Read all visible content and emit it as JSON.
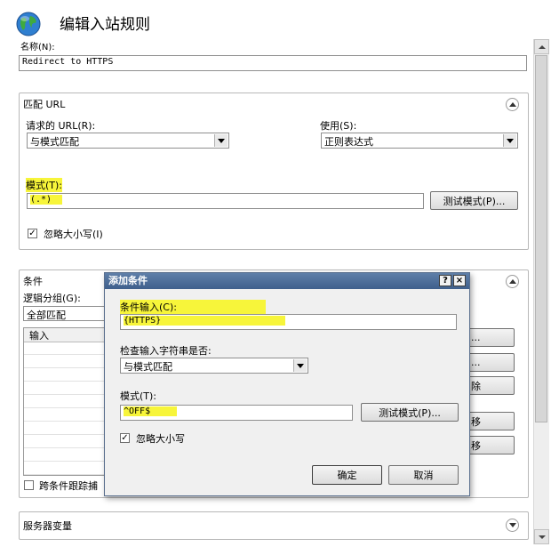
{
  "header": {
    "title": "编辑入站规则",
    "icon": "globe-icon"
  },
  "name_field": {
    "label": "名称(N):",
    "value": "Redirect to HTTPS"
  },
  "match_url": {
    "title": "匹配 URL",
    "requested_url_label": "请求的 URL(R):",
    "requested_url_value": "与模式匹配",
    "using_label": "使用(S):",
    "using_value": "正则表达式",
    "pattern_label": "模式(T):",
    "pattern_value": "(.*)",
    "test_pattern_button": "测试模式(P)...",
    "ignore_case_label": "忽略大小写(I)",
    "ignore_case_checked": true
  },
  "conditions": {
    "title": "条件",
    "logical_group_label": "逻辑分组(G):",
    "logical_group_value": "全部匹配",
    "table_header_input": "输入",
    "side_buttons": [
      "...",
      "...",
      "除",
      "移",
      "移"
    ],
    "track_captures_label": "跨条件跟踪捕"
  },
  "server_variables": {
    "title": "服务器变量"
  },
  "dialog": {
    "title": "添加条件",
    "help_button": "?",
    "close_button": "×",
    "condition_input_label": "条件输入(C):",
    "condition_input_value": "{HTTPS}",
    "check_input_label": "检查输入字符串是否:",
    "check_input_value": "与模式匹配",
    "pattern_label": "模式(T):",
    "pattern_value": "^OFF$",
    "test_pattern_button": "测试模式(P)...",
    "ignore_case_label": "忽略大小写",
    "ignore_case_checked": true,
    "ok_button": "确定",
    "cancel_button": "取消"
  },
  "colors": {
    "highlight": "#f7f53a",
    "dialog_title": "#4a6a96"
  }
}
